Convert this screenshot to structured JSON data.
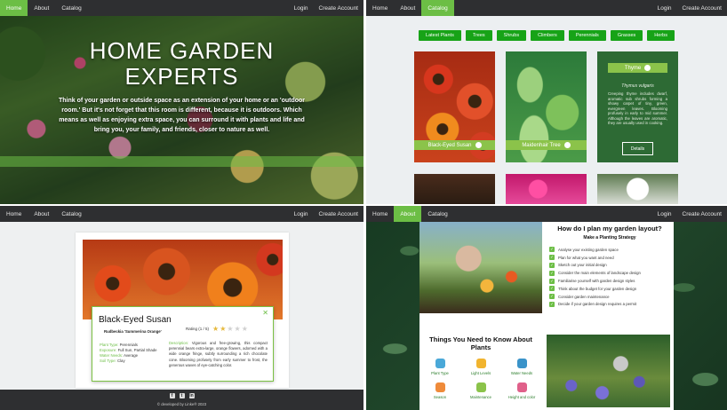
{
  "colors": {
    "accent": "#6cbe45",
    "nav_bg": "#2e2f31",
    "category_btn": "#17a317"
  },
  "panel1": {
    "nav": {
      "items": [
        "Home",
        "About",
        "Catalog"
      ],
      "active": "Home",
      "right": [
        "Login",
        "Create Account"
      ]
    },
    "hero": {
      "title_line1": "HOME GARDEN",
      "title_line2": "EXPERTS",
      "text": "Think of your garden or outside space as an extension of your home or an 'outdoor room.' But it's not forget that this room is different, because it is outdoors. Which means as well as enjoying extra space, you can surround it with plants and life and bring you, your family, and friends, closer to nature as well."
    }
  },
  "panel2": {
    "nav": {
      "items": [
        "Home",
        "About",
        "Catalog"
      ],
      "active": "Catalog",
      "right": [
        "Login",
        "Create Account"
      ]
    },
    "categories": [
      "Latest Plants",
      "Trees",
      "Shrubs",
      "Climbers",
      "Perennials",
      "Grasses",
      "Herbs"
    ],
    "cards": [
      {
        "name": "Black-Eyed Susan",
        "image": "black-eyed-susan-flowers"
      },
      {
        "name": "Maidenhair Tree",
        "image": "maidenhair-leaves"
      }
    ],
    "thyme": {
      "name": "Thyme",
      "scientific": "Thymus vulgaris",
      "description": "Creeping thyme includes dwarf, aromatic sub shrubs forming a showy carpet of tiny, green, evergreen leaves. Blooming profusely in early to mid summer. Although the leaves are aromatic, they are usually used in cooking.",
      "button": "Details"
    }
  },
  "panel3": {
    "nav": {
      "items": [
        "Home",
        "About",
        "Catalog"
      ],
      "active": "",
      "right": [
        "Login",
        "Create Account"
      ]
    },
    "plant": {
      "name": "Black-Eyed Susan",
      "scientific": "Rudbeckia 'Summerina Orange'",
      "rating_label": "Rating (1 / 5)",
      "rating": 2,
      "max_rating": 5,
      "facts": [
        {
          "k": "Plant Type:",
          "v": "Perennials"
        },
        {
          "k": "Exposure:",
          "v": "Full Sun, Partial Shade"
        },
        {
          "k": "Water Needs:",
          "v": "Average"
        },
        {
          "k": "Soil Type:",
          "v": "Clay"
        }
      ],
      "desc_label": "Description:",
      "description": "Vigorous and free-growing, this compact perennial bears extra-large, orange flowers, adorned with a wide orange fringe, subtly surrounding a rich chocolate cone. Blooming profusely from early summer to frost, the generous waves of eye-catching color."
    },
    "footer": {
      "icons": [
        "facebook-icon",
        "twitter-icon",
        "linkedin-icon"
      ],
      "copyright": "© developed by Linke® 2023"
    }
  },
  "panel4": {
    "nav": {
      "items": [
        "Home",
        "About",
        "Catalog"
      ],
      "active": "About",
      "right": [
        "Login",
        "Create Account"
      ]
    },
    "plan": {
      "title": "How do I plan my garden layout?",
      "subtitle": "Make a Planting Strategy",
      "steps": [
        "Analyse your existing garden space",
        "Plan for what you want and need",
        "Sketch out your initial design",
        "Consider the main elements of landscape design",
        "Familiarise yourself with garden design styles",
        "Think about the budget for your garden design",
        "Consider garden maintenance",
        "Decide if your garden design requires a permit"
      ]
    },
    "needs": {
      "title": "Things You Need to Know About Plants",
      "items": [
        {
          "label": "Plant Type",
          "color": "#4aa8d8"
        },
        {
          "label": "Light Levels",
          "color": "#f1b42f"
        },
        {
          "label": "Water Needs",
          "color": "#3a93c9"
        },
        {
          "label": "Season",
          "color": "#ef8b3a"
        },
        {
          "label": "Maintenance",
          "color": "#8bc34a"
        },
        {
          "label": "Height and color",
          "color": "#e0608a"
        }
      ]
    }
  }
}
